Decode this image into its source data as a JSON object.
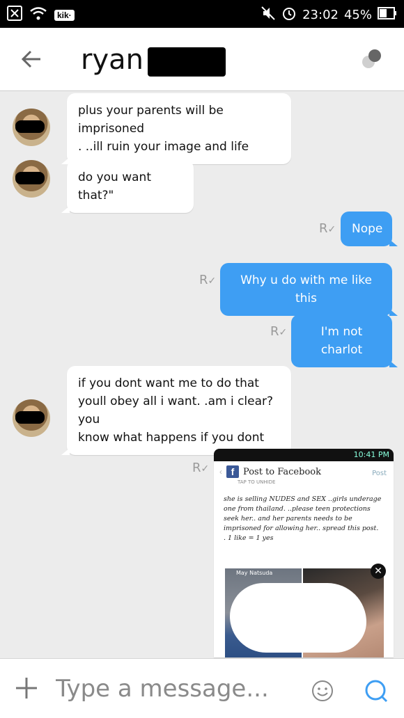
{
  "status_bar": {
    "left_icons": [
      "close-box-icon",
      "wifi-icon",
      "kik-icon"
    ],
    "kik_label": "kik·",
    "time": "23:02",
    "battery": "45%"
  },
  "header": {
    "contact_name": "ryan"
  },
  "messages": [
    {
      "direction": "in",
      "text_lines": [
        "plus your parents will be imprisoned",
        ". ..ill ruin your image and life"
      ]
    },
    {
      "direction": "in",
      "text_lines": [
        "do you want that?\""
      ]
    },
    {
      "direction": "out",
      "text": "Nope",
      "receipt": "R"
    },
    {
      "direction": "out",
      "text": "Why u do with me like this",
      "receipt": "R"
    },
    {
      "direction": "out",
      "text": "I'm not charlot",
      "receipt": "R"
    },
    {
      "direction": "in",
      "text_lines": [
        "if you dont want me to do that",
        "youll obey all i want. .am i clear?you",
        "know what happens if you dont"
      ]
    },
    {
      "direction": "out",
      "type": "image",
      "receipt": "R"
    }
  ],
  "image_card": {
    "mini_status": "10:41 PM",
    "fb_title": "Post to Facebook",
    "fb_post": "Post",
    "fb_sub": "TAP TO UNHIDE",
    "fb_text_lines": [
      "she is selling NUDES and SEX ..girls underage",
      "one from thailand. ..please teen protections",
      "seek her.. and her parents needs to be",
      "imprisoned for allowing her.. spread this post.",
      ". 1 like = 1 yes"
    ],
    "photo_label": "May Natsuda",
    "close": "✕"
  },
  "input_bar": {
    "placeholder": "Type a message..."
  },
  "colors": {
    "outgoing_bubble": "#3e9ef3",
    "background": "#ececec"
  }
}
